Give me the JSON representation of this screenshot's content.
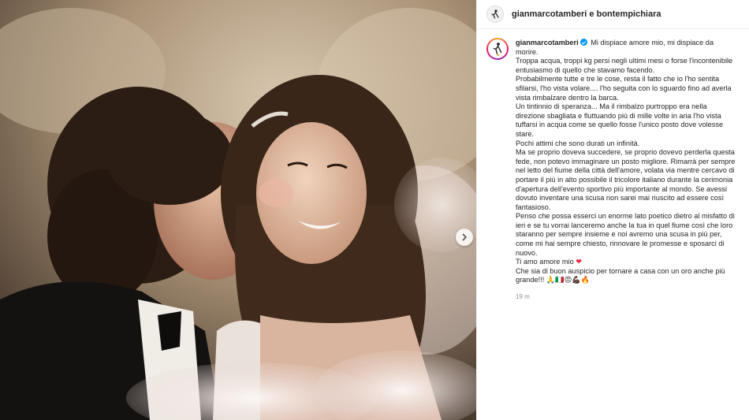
{
  "header": {
    "title": "gianmarcotamberi e bontempichiara"
  },
  "caption": {
    "username": "gianmarcotamberi",
    "first_text": "Mi dispiace amore mio, mi dispiace da morire.",
    "lines": [
      "Troppa acqua, troppi kg persi negli ultimi mesi o forse l'incontenibile entusiasmo di quello che stavamo facendo.",
      "Probabilmente tutte e tre le cose, resta il fatto che io l'ho sentita sfilarsi, l'ho vista volare.... l'ho seguita con lo sguardo fino ad averla vista rimbalzare dentro la barca.",
      "Un tintinnio di speranza... Ma il rimbalzo purtroppo era nella direzione sbagliata e fluttuando più di mille volte in aria l'ho vista tuffarsi in acqua come se quello fosse l'unico posto dove volesse stare.",
      "Pochi attimi che sono durati un infinità.",
      "Ma se proprio doveva succedere, se proprio dovevo perderla questa fede, non potevo immaginare un posto migliore. Rimarrà per sempre nel letto del fiume della città dell'amore, volata via mentre cercavo di portare il più in alto possibile il tricolore italiano durante la cerimonia d'apertura dell'evento sportivo più importante al mondo. Se avessi dovuto inventare una scusa non sarei mai riuscito ad essere così fantasioso.",
      "Penso che possa esserci un enorme lato poetico dietro al misfatto di ieri e se tu vorrai lanceremo anche la tua in quel fiume così che loro staranno per sempre insieme e noi avremo una scusa in più per, come mi hai sempre chiesto, rinnovare le promesse e sposarci di nuovo."
    ],
    "love_text": "Ti amo amore mio",
    "love_emoji": "❤",
    "last_line": "Che sia di buon auspicio per tornare a casa con un oro anche più grande!!! 🙏🇮🇹😡💪🏿🔥",
    "timestamp": "19 m"
  },
  "icons": {
    "verified": "verified-badge-icon",
    "next": "chevron-right-icon",
    "avatar": "athlete-silhouette-icon"
  },
  "colors": {
    "accent_blue": "#0095f6",
    "heart_red": "#ed1c3c"
  }
}
